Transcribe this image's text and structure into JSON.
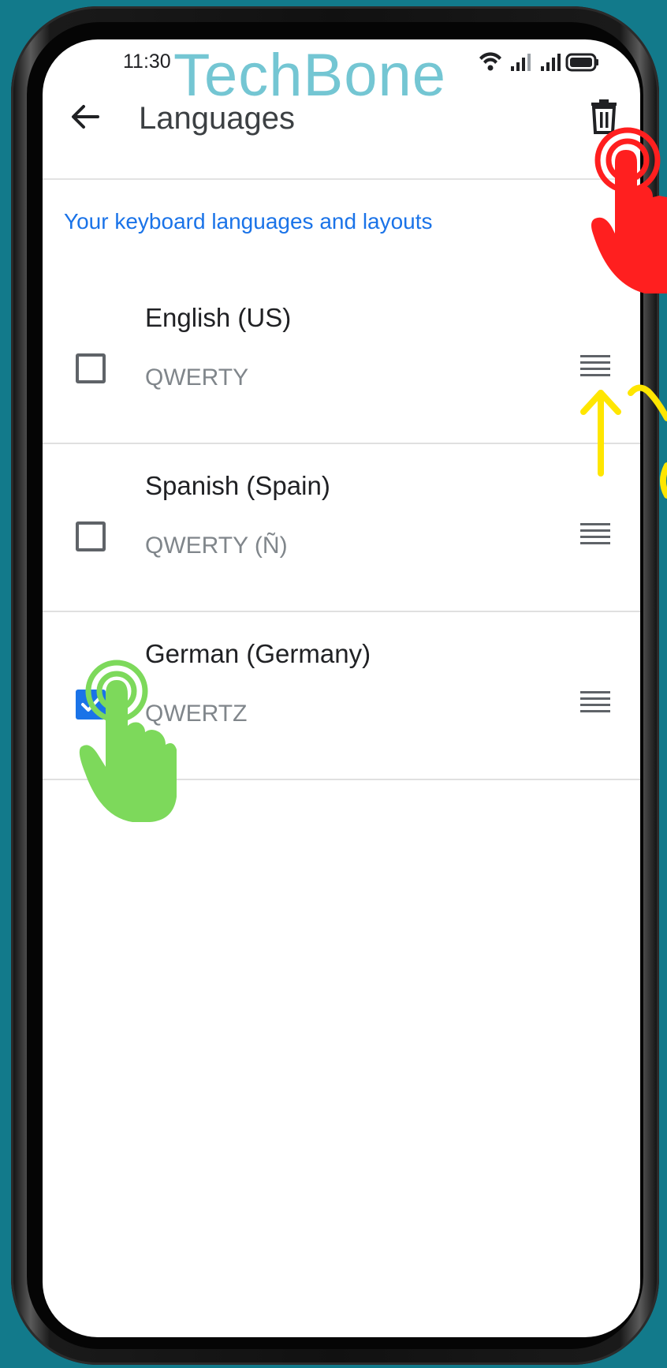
{
  "status_bar": {
    "time": "11:30",
    "icons": [
      "wifi-icon",
      "signal-icon",
      "signal-icon",
      "battery-icon"
    ]
  },
  "watermark": "TechBone",
  "app_bar": {
    "title": "Languages",
    "back_icon": "arrow-left-icon",
    "delete_icon": "trash-icon"
  },
  "section": {
    "heading": "Your keyboard languages and layouts"
  },
  "languages": [
    {
      "name": "English (US)",
      "layout": "QWERTY",
      "checked": false
    },
    {
      "name": "Spanish (Spain)",
      "layout": "QWERTY (Ñ)",
      "checked": false
    },
    {
      "name": "German (Germany)",
      "layout": "QWERTZ",
      "checked": true
    }
  ],
  "colors": {
    "background": "#127a8b",
    "accent": "#1a73e8",
    "watermark": "#74c6d3",
    "tap_red": "#ff1f1f",
    "tap_green": "#7dd95b",
    "arrow_yellow": "#ffe600"
  }
}
